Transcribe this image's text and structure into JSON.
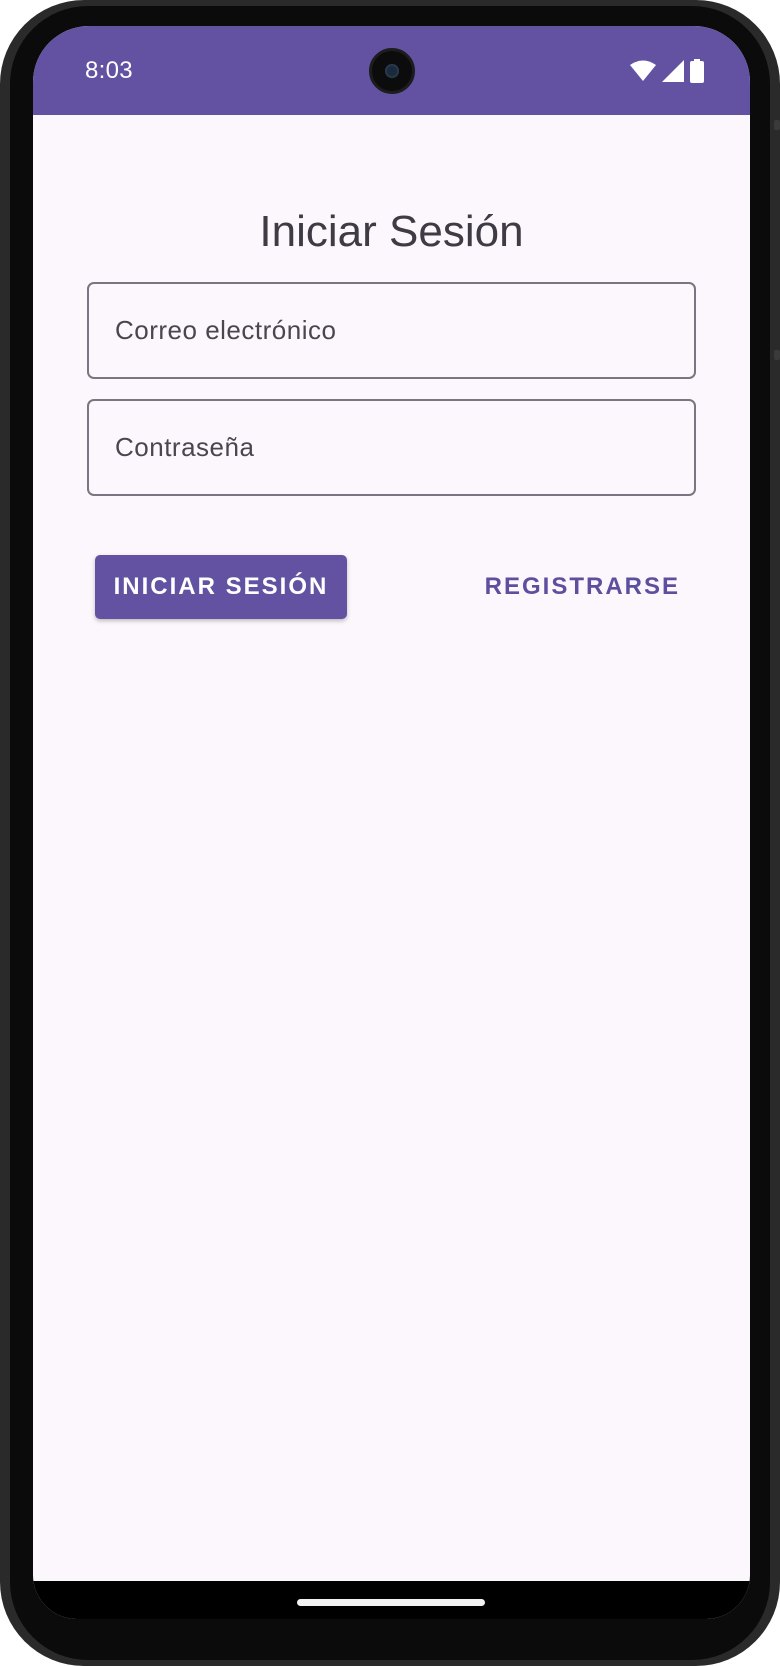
{
  "status_bar": {
    "time": "8:03",
    "background_color": "#6352a2",
    "icons": [
      "wifi-icon",
      "cellular-signal-icon",
      "battery-icon"
    ]
  },
  "login": {
    "title": "Iniciar Sesión",
    "email_placeholder": "Correo electrónico",
    "email_value": "",
    "password_placeholder": "Contraseña",
    "password_value": "",
    "login_button_label": "INICIAR SESIÓN",
    "register_button_label": "REGISTRARSE"
  },
  "colors": {
    "accent": "#6352a2",
    "background": "#fcf7fc",
    "text": "#3e3b45"
  }
}
